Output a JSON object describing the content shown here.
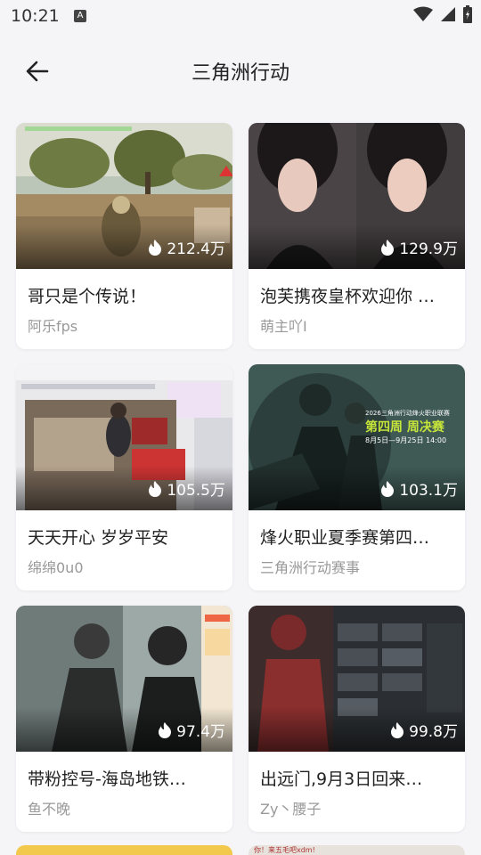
{
  "status": {
    "time": "10:21",
    "a_badge": "A"
  },
  "header": {
    "title": "三角洲行动"
  },
  "videos": [
    {
      "title": "哥只是个传说！",
      "author": "阿乐fps",
      "views": "212.4万",
      "thumb": "field"
    },
    {
      "title": "泡芙携夜皇杯欢迎你 …",
      "author": "萌主吖I",
      "views": "129.9万",
      "thumb": "portrait"
    },
    {
      "title": "天天开心 岁岁平安",
      "author": "绵绵0u0",
      "views": "105.5万",
      "thumb": "room"
    },
    {
      "title": "烽火职业夏季赛第四…",
      "author": "三角洲行动赛事",
      "views": "103.1万",
      "thumb": "poster",
      "poster_text": [
        "2026三角洲行动烽火职业联赛",
        "第四周 周决赛",
        "8月5日—9月25日 14:00"
      ]
    },
    {
      "title": "带粉控号-海岛地铁…",
      "author": "鱼不晚",
      "views": "97.4万",
      "thumb": "soldier"
    },
    {
      "title": "出远门,9月3日回来…",
      "author": "Zy丶腰子",
      "views": "99.8万",
      "thumb": "inventory"
    }
  ],
  "partial": {
    "right_text": "你！来五毛吧xdm!"
  },
  "colors": {
    "background": "#f5f5f8",
    "card": "#ffffff",
    "title": "#222222",
    "author": "#999999",
    "poster_accent": "#c6e43a"
  }
}
